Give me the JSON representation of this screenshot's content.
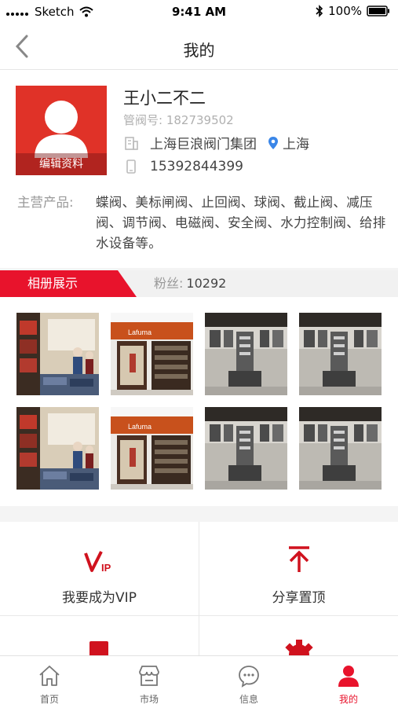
{
  "status_bar": {
    "carrier": "Sketch",
    "time": "9:41 AM",
    "battery": "100%"
  },
  "nav": {
    "title": "我的"
  },
  "profile": {
    "name": "王小二不二",
    "member_no": "管阀号: 182739502",
    "company": "上海巨浪阀门集团",
    "city": "上海",
    "phone": "15392844399",
    "edit_label": "编辑资料",
    "products_label": "主营产品:",
    "products_text": "蝶阀、美标闸阀、止回阀、球阀、截止阀、减压阀、调节阀、电磁阀、安全阀、水力控制阀、给排水设备等。"
  },
  "album": {
    "tab_label": "相册展示",
    "fans_label": "粉丝:",
    "fans_count": "10292"
  },
  "gallery": {
    "photos": [
      {
        "kind": "store-clothing"
      },
      {
        "kind": "lafuma-storefront"
      },
      {
        "kind": "store-interior"
      },
      {
        "kind": "store-interior"
      },
      {
        "kind": "store-clothing"
      },
      {
        "kind": "lafuma-storefront"
      },
      {
        "kind": "store-interior"
      },
      {
        "kind": "store-interior"
      }
    ],
    "brand_sign": "Lafuma"
  },
  "tiles": [
    {
      "label": "我要成为VIP",
      "icon": "vip-icon"
    },
    {
      "label": "分享置顶",
      "icon": "pin-top-icon"
    },
    {
      "label": "",
      "icon": "truck-icon"
    },
    {
      "label": "",
      "icon": "gear-icon"
    }
  ],
  "tabbar": [
    {
      "label": "首页",
      "icon": "home-icon",
      "active": false
    },
    {
      "label": "市场",
      "icon": "market-icon",
      "active": false
    },
    {
      "label": "信息",
      "icon": "message-icon",
      "active": false
    },
    {
      "label": "我的",
      "icon": "user-icon",
      "active": true
    }
  ],
  "colors": {
    "accent": "#e8132c",
    "avatar_bg": "#e03228",
    "icon_red": "#d0121e"
  }
}
